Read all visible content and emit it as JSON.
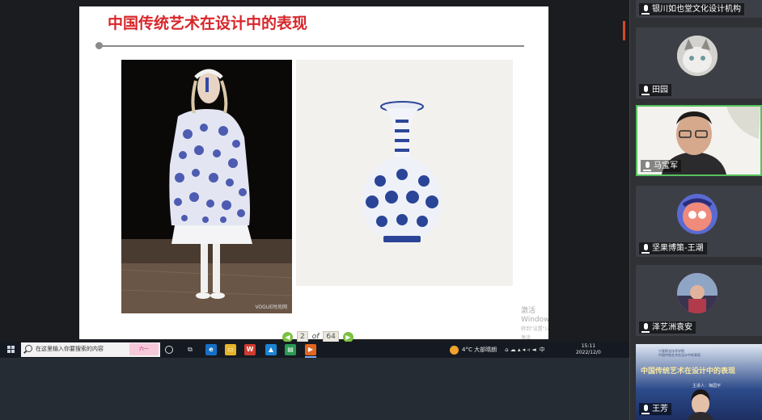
{
  "slide": {
    "title": "中国传统艺术在设计中的表现",
    "photo_credit": "VOGUE时尚网",
    "watermark_line1": "激活 Windows",
    "watermark_line2": "转到\"设置\"以激活 Windows。"
  },
  "pager": {
    "prev": "◀",
    "current": "2",
    "of": "of",
    "total": "64",
    "next": "▶"
  },
  "taskbar": {
    "search_placeholder": "在这里输入你要搜索的内容",
    "search_badge": "六一",
    "weather": "4°C 大部晴朗",
    "ime": "中",
    "time": "15:11",
    "date": "2022/12/0"
  },
  "participants": [
    {
      "name": "银川如也堂文化设计机构",
      "avatar": "none"
    },
    {
      "name": "田园",
      "avatar": "cat"
    },
    {
      "name": "马宝军",
      "avatar": "camera",
      "speaking": true
    },
    {
      "name": "坚果博策-王潮",
      "avatar": "cartoon"
    },
    {
      "name": "泽艺洲袁安",
      "avatar": "photo"
    },
    {
      "name": "王芳",
      "avatar": "shared-slide"
    }
  ],
  "shared_slide": {
    "header_line1": "宁夏职业技术学院",
    "header_line2": "中国传统艺术在设计中的表现",
    "title": "中国传统艺术在设计中的表现",
    "speaker": "主讲人：梅国宇"
  },
  "colors": {
    "title_red": "#d7262a",
    "active_border": "#55c25e",
    "pager_green": "#7bc142"
  }
}
